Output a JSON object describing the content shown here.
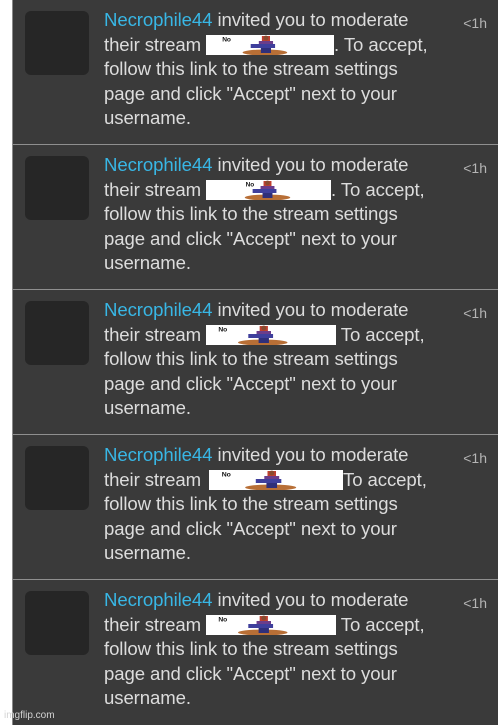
{
  "notifications": [
    {
      "username": "Necrophile44",
      "line1_after": " invited you to moderate",
      "line2_before": "their stream ",
      "line2_after": ". To accept,",
      "line3": "follow this link to the stream settings",
      "line4": "page and click \"Accept\" next to your",
      "line5": "username.",
      "time": "<1h",
      "emote_text": "No"
    },
    {
      "username": "Necrophile44",
      "line1_after": " invited you to moderate",
      "line2_before": "their stream ",
      "line2_after": ". To accept,",
      "line3": "follow this link to the stream settings",
      "line4": "page and click \"Accept\" next to your",
      "line5": "username.",
      "time": "<1h",
      "emote_text": "No"
    },
    {
      "username": "Necrophile44",
      "line1_after": " invited you to moderate",
      "line2_before": "their stream ",
      "line2_after": " To accept,",
      "line3": "follow this link to the stream settings",
      "line4": "page and click \"Accept\" next to your",
      "line5": "username.",
      "time": "<1h",
      "emote_text": "No"
    },
    {
      "username": "Necrophile44",
      "line1_after": " invited you to moderate",
      "line2_before": "their stream ",
      "line2_after": "To accept,",
      "line3": "follow this link to the stream settings",
      "line4": "page and click \"Accept\" next to your",
      "line5": "username.",
      "time": "<1h",
      "emote_text": "No"
    },
    {
      "username": "Necrophile44",
      "line1_after": " invited you to moderate",
      "line2_before": "their stream ",
      "line2_after": " To accept,",
      "line3": "follow this link to the stream settings",
      "line4": "page and click \"Accept\" next to your",
      "line5": "username.",
      "time": "<1h",
      "emote_text": "No"
    }
  ],
  "watermark": "imgflip.com",
  "colors": {
    "background": "#3a3a3a",
    "text": "#dcdcdc",
    "username": "#38b7e6",
    "timestamp": "#b5b5b5",
    "divider": "#8f8f8f"
  }
}
